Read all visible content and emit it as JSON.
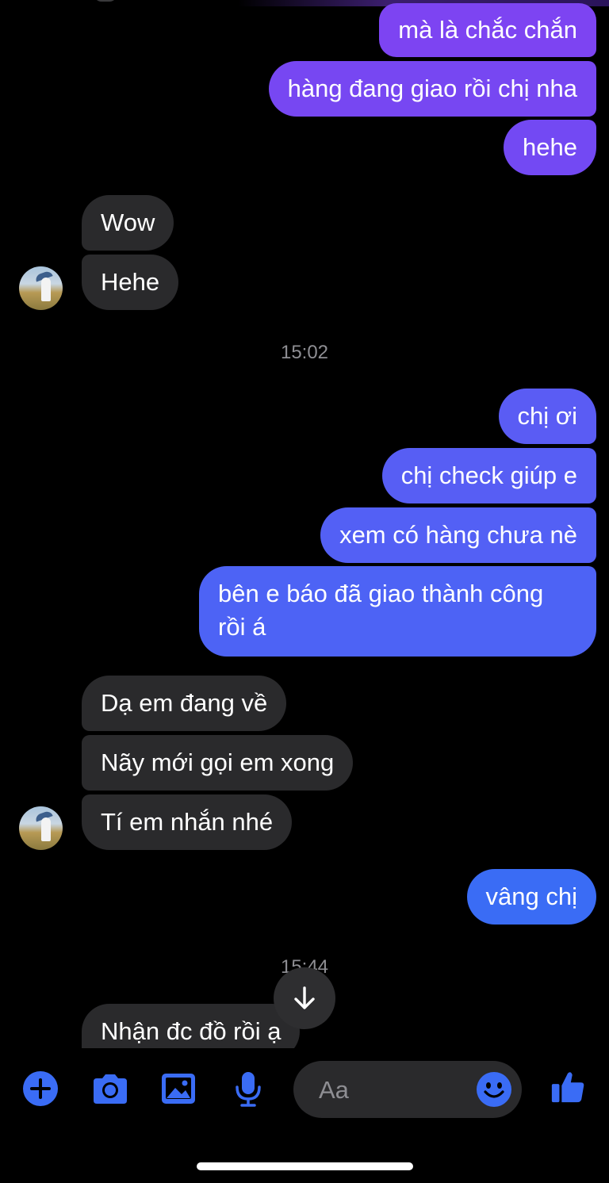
{
  "colors": {
    "accent": "#3a6cf5",
    "out_purple": "#7b47f2",
    "out_blue": "#4a66f5",
    "incoming_bg": "#2a2a2c",
    "timestamp": "#8e8e93"
  },
  "messages_top": {
    "out1": "mà là chắc chắn",
    "out2": "hàng đang giao rồi chị nha",
    "out3": "hehe",
    "in1": "Wow",
    "in2": "Hehe"
  },
  "timestamp1": "15:02",
  "messages_mid": {
    "out1": "chị ơi",
    "out2": "chị check giúp e",
    "out3": "xem có hàng chưa nè",
    "out4_line1": "bên e báo đã giao thành công",
    "out4_line2": "rồi á",
    "in1": "Dạ em đang về",
    "in2": "Nãy mới gọi em xong",
    "in3": "Tí em nhắn nhé",
    "out5": "vâng chị"
  },
  "timestamp2": "15:44",
  "messages_bottom": {
    "in1": "Nhận đc đồ rồi ạ"
  },
  "composer": {
    "placeholder": "Aa"
  },
  "icons": {
    "add": "plus-circle-icon",
    "camera": "camera-icon",
    "gallery": "image-icon",
    "mic": "microphone-icon",
    "emoji": "smiley-icon",
    "like": "thumbs-up-icon",
    "scroll": "arrow-down-icon"
  }
}
